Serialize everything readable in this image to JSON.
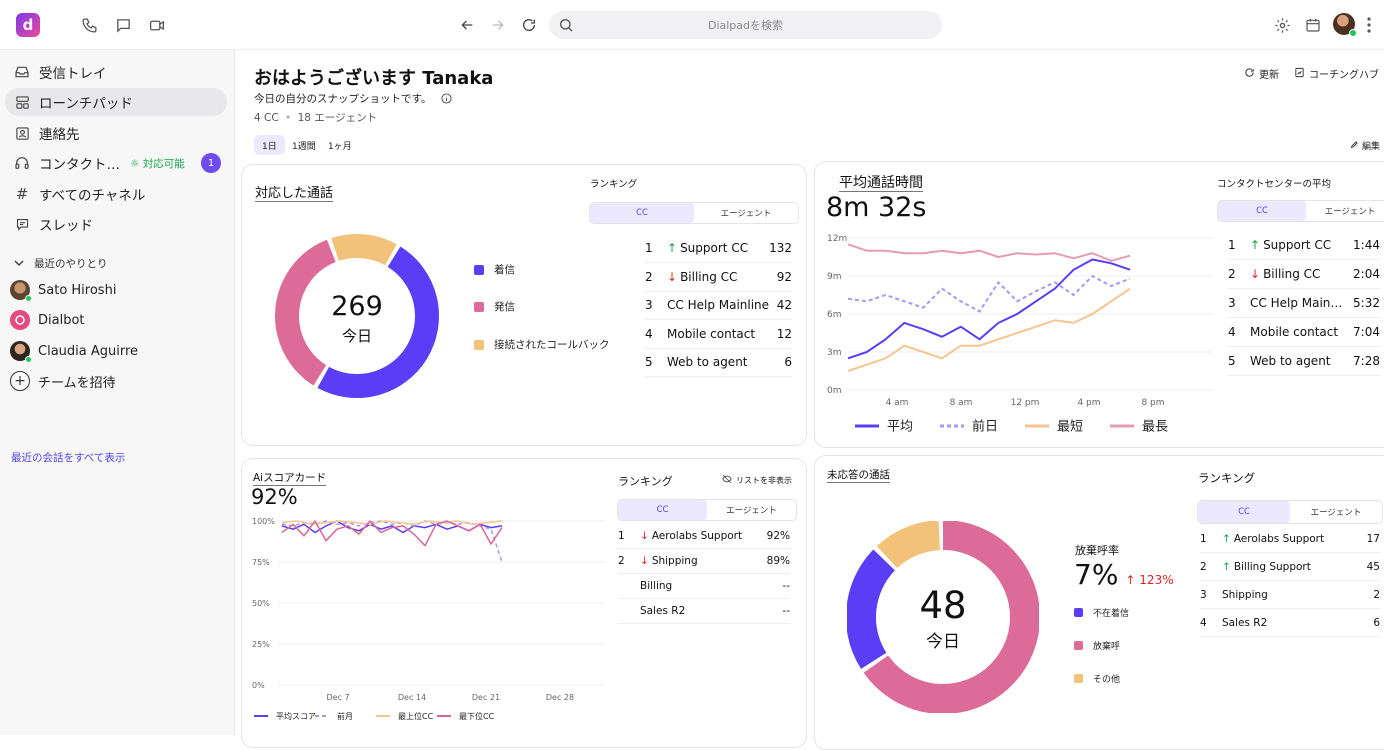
{
  "topbar": {
    "logo_letter": "d",
    "search_placeholder": "Dialpadを検索",
    "icons": [
      "phone-icon",
      "chat-icon",
      "video-icon",
      "back-icon",
      "forward-icon",
      "reload-icon",
      "search-icon",
      "gear-icon",
      "calendar-icon",
      "more-icon"
    ]
  },
  "sidebar": {
    "items": [
      {
        "label": "受信トレイ",
        "icon": "inbox-icon"
      },
      {
        "label": "ローンチパッド",
        "icon": "launchpad-icon"
      },
      {
        "label": "連絡先",
        "icon": "contacts-icon"
      },
      {
        "label": "コンタクト…",
        "icon": "headset-icon",
        "status": "対応可能",
        "badge": "1"
      },
      {
        "label": "すべてのチャネル",
        "icon": "hash-icon"
      },
      {
        "label": "スレッド",
        "icon": "thread-icon"
      }
    ],
    "recent_title": "最近のやりとり",
    "recent": [
      {
        "name": "Sato Hiroshi"
      },
      {
        "name": "Dialbot"
      },
      {
        "name": "Claudia Aguirre"
      }
    ],
    "invite_label": "チームを招待",
    "show_all": "最近の会話をすべて表示"
  },
  "header": {
    "greeting": "おはようございます Tanaka",
    "subtitle": "今日の自分のスナップショットです。",
    "meta_cc": "4 CC",
    "meta_agents": "18 エージェント",
    "ranges": [
      "1日",
      "1週間",
      "1ヶ月"
    ],
    "refresh": "更新",
    "coaching": "コーチングハブ",
    "edit": "編集"
  },
  "calls_card": {
    "title": "対応した通話",
    "total": "269",
    "total_label": "今日",
    "legend": [
      {
        "label": "着信",
        "color": "#5b3df5"
      },
      {
        "label": "発信",
        "color": "#dd6b98"
      },
      {
        "label": "接続されたコールバック",
        "color": "#f2c27a"
      }
    ],
    "slices": [
      {
        "label": "着信",
        "value": 0.5,
        "color": "#5b3df5"
      },
      {
        "label": "発信",
        "value": 0.36,
        "color": "#dd6b98"
      },
      {
        "label": "接続されたコールバック",
        "value": 0.14,
        "color": "#f2c27a"
      }
    ],
    "ranking_title": "ランキング",
    "tabs": [
      "CC",
      "エージェント"
    ],
    "ranking": [
      {
        "n": "1",
        "dir": "up",
        "name": "Support CC",
        "value": "132"
      },
      {
        "n": "2",
        "dir": "down",
        "name": "Billing CC",
        "value": "92"
      },
      {
        "n": "3",
        "dir": "",
        "name": "CC Help Mainline",
        "value": "42"
      },
      {
        "n": "4",
        "dir": "",
        "name": "Mobile contact",
        "value": "12"
      },
      {
        "n": "5",
        "dir": "",
        "name": "Web to agent",
        "value": "6"
      }
    ]
  },
  "talk_card": {
    "title": "平均通話時間",
    "value": "8m 32s",
    "ranking_title": "コンタクトセンターの平均",
    "tabs": [
      "CC",
      "エージェント"
    ],
    "ranking": [
      {
        "n": "1",
        "dir": "up",
        "name": "Support CC",
        "value": "1:44"
      },
      {
        "n": "2",
        "dir": "down",
        "name": "Billing CC",
        "value": "2:04"
      },
      {
        "n": "3",
        "dir": "",
        "name": "CC Help Main…",
        "value": "5:32"
      },
      {
        "n": "4",
        "dir": "",
        "name": "Mobile contact",
        "value": "7:04"
      },
      {
        "n": "5",
        "dir": "",
        "name": "Web to agent",
        "value": "7:28"
      }
    ],
    "legend": [
      "平均",
      "前日",
      "最短",
      "最長"
    ],
    "chart_data": {
      "type": "line",
      "x": [
        "4 am",
        "8 am",
        "12 pm",
        "4 pm",
        "8 pm"
      ],
      "y_ticks": [
        "12m",
        "9m",
        "6m",
        "3m",
        "0m"
      ],
      "ylim": [
        0,
        12
      ],
      "series": [
        {
          "name": "平均",
          "color": "#5b3df5",
          "dash": "",
          "values": [
            2.5,
            3.0,
            4.0,
            5.3,
            4.8,
            4.2,
            5.0,
            4.0,
            5.3,
            6.0,
            7.0,
            8.0,
            9.5,
            10.3,
            10.0,
            9.5
          ]
        },
        {
          "name": "前日",
          "color": "#a69af8",
          "dash": "4 3",
          "values": [
            7.2,
            7.0,
            7.5,
            7.0,
            6.5,
            8.0,
            7.0,
            6.2,
            8.5,
            7.0,
            7.8,
            8.5,
            7.5,
            9.0,
            8.2,
            8.8
          ]
        },
        {
          "name": "最短",
          "color": "#f7c48f",
          "dash": "",
          "values": [
            1.5,
            2.0,
            2.5,
            3.5,
            3.0,
            2.5,
            3.5,
            3.5,
            4.0,
            4.5,
            5.0,
            5.5,
            5.3,
            6.0,
            7.0,
            8.0
          ]
        },
        {
          "name": "最長",
          "color": "#e49bb5",
          "dash": "",
          "values": [
            11.5,
            11.0,
            11.0,
            10.8,
            10.8,
            11.0,
            10.8,
            11.0,
            10.5,
            10.8,
            10.7,
            10.8,
            10.4,
            10.8,
            10.2,
            10.6
          ]
        }
      ]
    }
  },
  "ai_card": {
    "title": "Aiスコアカード",
    "value": "92%",
    "ranking_title": "ランキング",
    "hide_list": "リストを非表示",
    "tabs": [
      "CC",
      "エージェント"
    ],
    "ranking": [
      {
        "n": "1",
        "dir": "down",
        "name": "Aerolabs Support",
        "value": "92%"
      },
      {
        "n": "2",
        "dir": "down",
        "name": "Shipping",
        "value": "89%"
      },
      {
        "n": "",
        "dir": "",
        "name": "Billing",
        "value": "--"
      },
      {
        "n": "",
        "dir": "",
        "name": "Sales R2",
        "value": "--"
      }
    ],
    "legend": [
      "平均スコア",
      "前月",
      "最上位CC",
      "最下位CC"
    ],
    "chart_data": {
      "type": "line",
      "x": [
        "Dec 7",
        "Dec 14",
        "Dec 21",
        "Dec 28"
      ],
      "y_ticks": [
        "100%",
        "75%",
        "50%",
        "25%",
        "0%"
      ],
      "ylim": [
        0,
        100
      ],
      "series": [
        {
          "name": "平均スコア",
          "color": "#5b3df5",
          "dash": "",
          "values": [
            97,
            95,
            98,
            93,
            97,
            100,
            96,
            94,
            98,
            95,
            97,
            93,
            97,
            96,
            98,
            95,
            97,
            94,
            98,
            96,
            97
          ]
        },
        {
          "name": "前月",
          "color": "#a69af8",
          "dash": "4 3",
          "values": [
            98,
            97,
            99,
            98,
            100,
            98,
            99,
            97,
            99,
            100,
            98,
            99,
            97,
            100,
            98,
            99,
            98,
            99,
            97,
            95,
            75
          ]
        },
        {
          "name": "最上位CC",
          "color": "#f7c48f",
          "dash": "",
          "values": [
            99,
            100,
            98,
            99,
            100,
            99,
            98,
            100,
            99,
            98,
            100,
            99,
            100,
            98,
            99,
            100
          ]
        },
        {
          "name": "最下位CC",
          "color": "#d8689a",
          "dash": "",
          "values": [
            93,
            98,
            91,
            100,
            88,
            95,
            97,
            92,
            100,
            93,
            96,
            97,
            92,
            85,
            98,
            100,
            97,
            94,
            98,
            86,
            96
          ]
        }
      ]
    }
  },
  "missed_card": {
    "title": "未応答の通話",
    "total": "48",
    "total_label": "今日",
    "abandon_title": "放棄呼率",
    "abandon_value": "7%",
    "abandon_change": "123%",
    "legend": [
      {
        "label": "不在着信",
        "color": "#5b3df5"
      },
      {
        "label": "放棄呼",
        "color": "#dd6b98"
      },
      {
        "label": "その他",
        "color": "#f2c27a"
      }
    ],
    "slices": [
      {
        "label": "放棄呼",
        "value": 0.66,
        "color": "#dd6b98"
      },
      {
        "label": "不在着信",
        "value": 0.22,
        "color": "#5b3df5"
      },
      {
        "label": "その他",
        "value": 0.12,
        "color": "#f2c27a"
      }
    ],
    "ranking_title": "ランキング",
    "tabs": [
      "CC",
      "エージェント"
    ],
    "ranking": [
      {
        "n": "1",
        "dir": "up",
        "name": "Aerolabs Support",
        "value": "17"
      },
      {
        "n": "2",
        "dir": "up",
        "name": "Billing Support",
        "value": "45"
      },
      {
        "n": "3",
        "dir": "",
        "name": "Shipping",
        "value": "2"
      },
      {
        "n": "4",
        "dir": "",
        "name": "Sales R2",
        "value": "6"
      }
    ]
  }
}
